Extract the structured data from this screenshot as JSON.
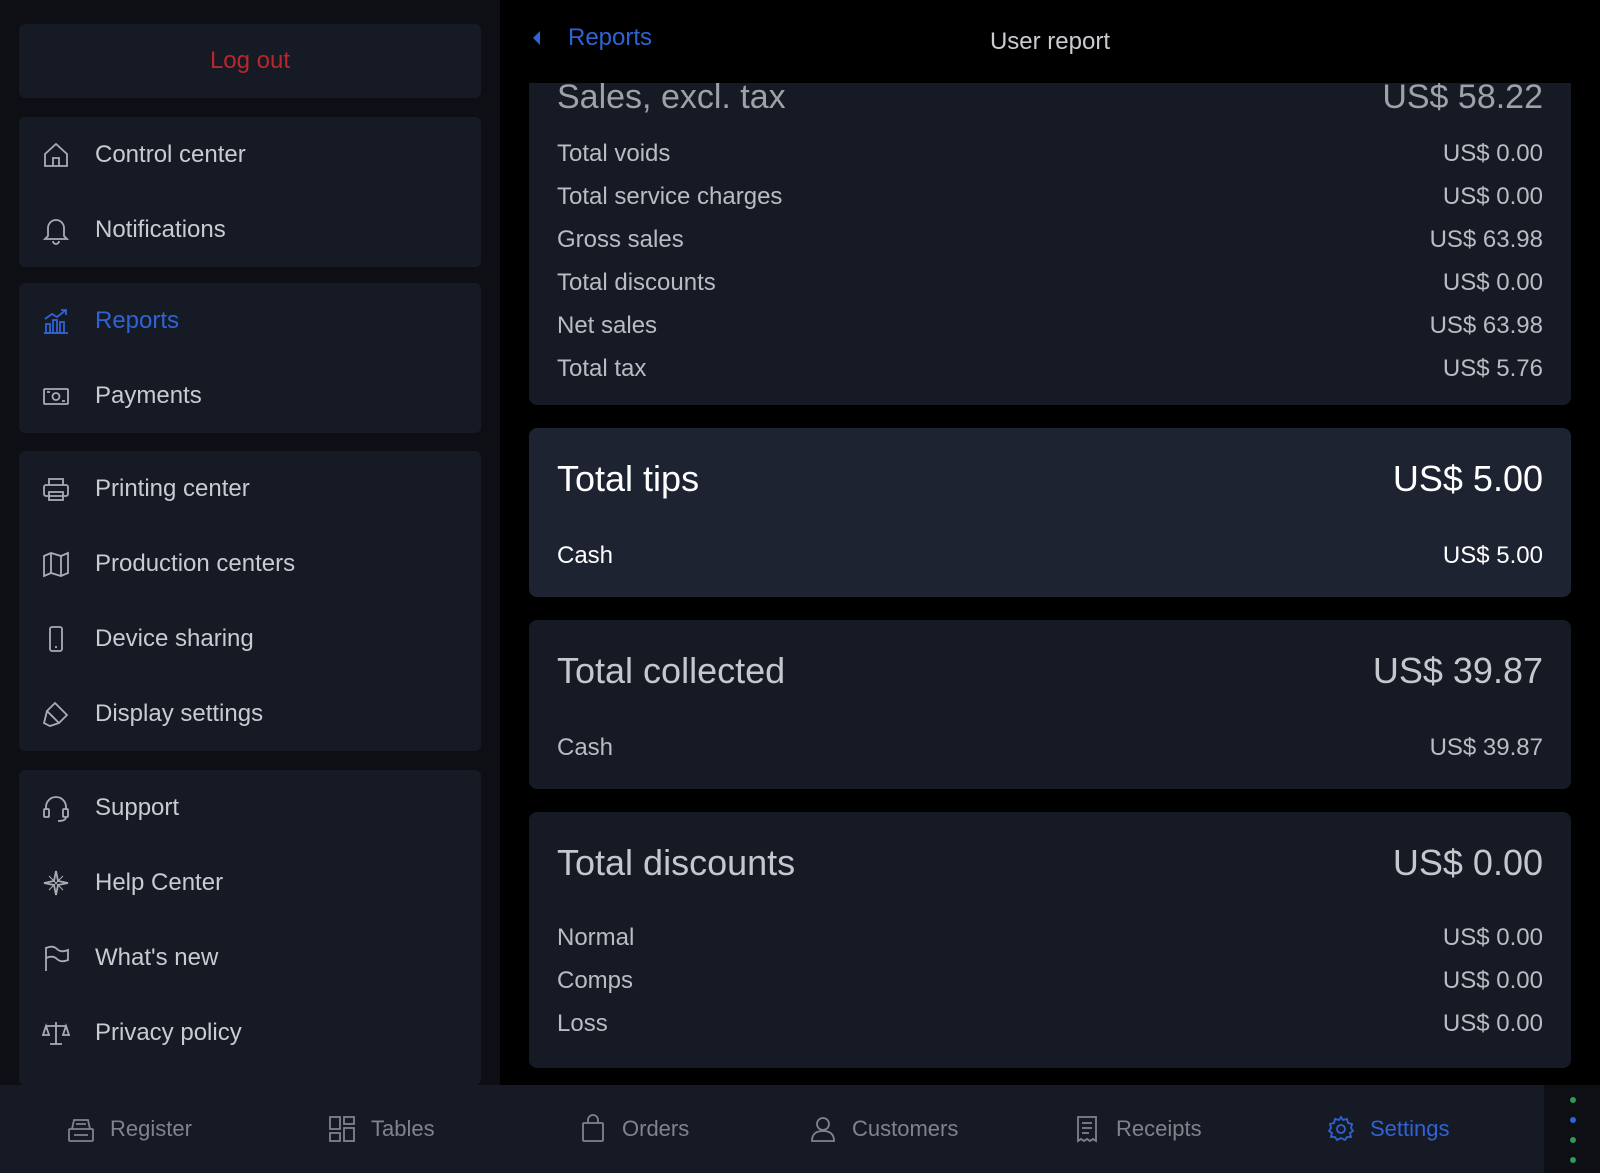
{
  "sidebar": {
    "logout_label": "Log out",
    "groups": [
      {
        "items": [
          {
            "label": "Control center",
            "icon": "home-icon"
          },
          {
            "label": "Notifications",
            "icon": "bell-icon"
          }
        ]
      },
      {
        "items": [
          {
            "label": "Reports",
            "icon": "chart-icon",
            "active": true
          },
          {
            "label": "Payments",
            "icon": "cash-icon"
          }
        ]
      },
      {
        "items": [
          {
            "label": "Printing center",
            "icon": "printer-icon"
          },
          {
            "label": "Production centers",
            "icon": "map-icon"
          },
          {
            "label": "Device sharing",
            "icon": "phone-icon"
          },
          {
            "label": "Display settings",
            "icon": "paint-icon"
          }
        ]
      },
      {
        "items": [
          {
            "label": "Support",
            "icon": "headset-icon"
          },
          {
            "label": "Help Center",
            "icon": "compass-icon"
          },
          {
            "label": "What's new",
            "icon": "flag-icon"
          },
          {
            "label": "Privacy policy",
            "icon": "scale-icon"
          }
        ]
      }
    ]
  },
  "header": {
    "back_label": "Reports",
    "title": "User report"
  },
  "sales": {
    "cut_label": "Sales, excl. tax",
    "cut_value": "US$ 58.22",
    "rows": [
      {
        "label": "Total voids",
        "value": "US$ 0.00"
      },
      {
        "label": "Total service charges",
        "value": "US$ 0.00"
      },
      {
        "label": "Gross sales",
        "value": "US$ 63.98"
      },
      {
        "label": "Total discounts",
        "value": "US$ 0.00"
      },
      {
        "label": "Net sales",
        "value": "US$ 63.98"
      },
      {
        "label": "Total tax",
        "value": "US$ 5.76"
      }
    ]
  },
  "tips": {
    "title": "Total tips",
    "total": "US$ 5.00",
    "rows": [
      {
        "label": "Cash",
        "value": "US$ 5.00"
      }
    ]
  },
  "collected": {
    "title": "Total collected",
    "total": "US$ 39.87",
    "rows": [
      {
        "label": "Cash",
        "value": "US$ 39.87"
      }
    ]
  },
  "discounts": {
    "title": "Total discounts",
    "total": "US$ 0.00",
    "rows": [
      {
        "label": "Normal",
        "value": "US$ 0.00"
      },
      {
        "label": "Comps",
        "value": "US$ 0.00"
      },
      {
        "label": "Loss",
        "value": "US$ 0.00"
      }
    ]
  },
  "tabbar": {
    "tabs": [
      {
        "label": "Register",
        "icon": "register-icon"
      },
      {
        "label": "Tables",
        "icon": "tables-icon"
      },
      {
        "label": "Orders",
        "icon": "bag-icon"
      },
      {
        "label": "Customers",
        "icon": "person-icon"
      },
      {
        "label": "Receipts",
        "icon": "receipt-icon"
      },
      {
        "label": "Settings",
        "icon": "gear-icon",
        "active": true
      }
    ]
  },
  "colors": {
    "accent": "#2f63d4",
    "logout": "#b8272c",
    "card": "#161a24",
    "tips_card": "#1e2331"
  }
}
